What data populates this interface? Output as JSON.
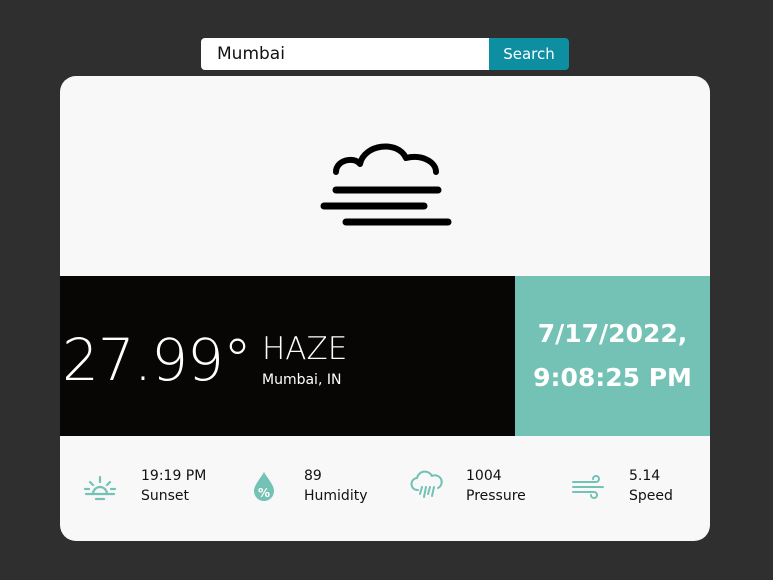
{
  "search": {
    "value": "Mumbai",
    "button_label": "Search"
  },
  "weather": {
    "icon": "haze-icon",
    "temperature": "27.99°",
    "condition": "HAZE",
    "location": "Mumbai, IN"
  },
  "datetime": {
    "date": "7/17/2022,",
    "time": "9:08:25 PM"
  },
  "stats": [
    {
      "icon": "sunset-icon",
      "value": "19:19 PM",
      "label": "Sunset"
    },
    {
      "icon": "humidity-icon",
      "value": "89",
      "label": "Humidity"
    },
    {
      "icon": "pressure-icon",
      "value": "1004",
      "label": "Pressure"
    },
    {
      "icon": "wind-speed-icon",
      "value": "5.14",
      "label": "Speed"
    }
  ],
  "colors": {
    "page_background": "#2f2f2f",
    "card_background": "#f8f8f8",
    "accent_teal": "#73c2b5",
    "search_button": "#0e8fa1",
    "temp_band": "#070605"
  }
}
